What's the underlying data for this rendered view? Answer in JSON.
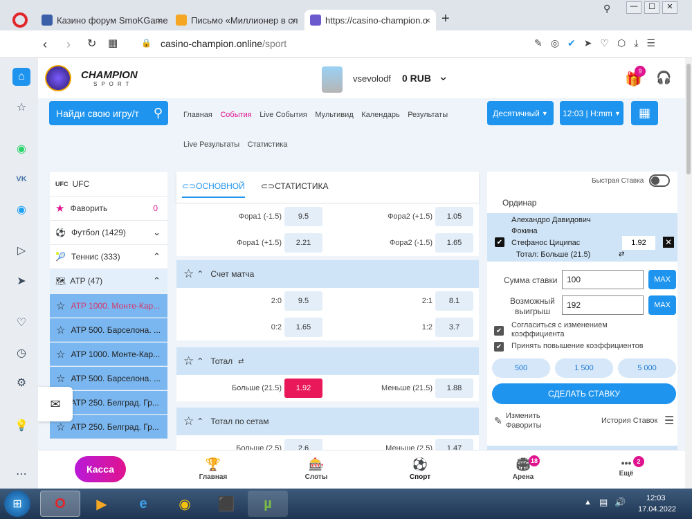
{
  "browser": {
    "tabs": [
      {
        "title": "Казино форум SmoKGame",
        "close": "×"
      },
      {
        "title": "Письмо «Миллионер в сл",
        "close": "×"
      },
      {
        "title": "https://casino-champion.o",
        "close": "×"
      }
    ],
    "new_tab": "+",
    "url_host": "casino-champion.online",
    "url_path": "/sport",
    "window_controls": [
      "—",
      "☐",
      "✕"
    ],
    "icons": [
      "search-icon",
      "menu-icon",
      "minimize-icon",
      "maximize-icon",
      "close-icon"
    ]
  },
  "site": {
    "logo_title": "CHAMPION",
    "logo_sub": "SPORT",
    "username": "vsevolodf",
    "balance": "0 RUB",
    "gift_badge": "9",
    "search_label": "Найди свою игру/т",
    "nav": [
      "Главная",
      "События",
      "Live События",
      "Мультивид",
      "Календарь",
      "Результаты",
      "Live Результаты",
      "Статистика"
    ],
    "nav_active": "События",
    "odds_format": "Десятичный",
    "time_format": "12:03 | H:mm",
    "accent": "#1e94ee"
  },
  "left_menu": {
    "items": [
      {
        "icon": "UFC",
        "label": "UFC"
      },
      {
        "icon": "★",
        "label": "Фаворить",
        "count": "0"
      },
      {
        "icon": "⚽",
        "label": "Футбол (1429)"
      },
      {
        "icon": "🎾",
        "label": "Теннис (333)"
      },
      {
        "icon": "🗺",
        "label": "ATP (47)"
      }
    ],
    "subitems": [
      "ATP 1000. Монте-Кар...",
      "ATP 500. Барселона. ...",
      "ATP 1000. Монте-Кар...",
      "ATP 500. Барселона. ...",
      "ATP 250. Белград. Гр...",
      "ATP 250. Белград. Гр..."
    ]
  },
  "main": {
    "tabs": [
      "ОСНОВНОЙ",
      "СТАТИСТИКА"
    ],
    "rows": [
      {
        "l_label": "Фора1 (-1.5)",
        "l_odd": "9.5",
        "r_label": "Фора2 (+1.5)",
        "r_odd": "1.05"
      },
      {
        "l_label": "Фора1 (+1.5)",
        "l_odd": "2.21",
        "r_label": "Фора2 (-1.5)",
        "r_odd": "1.65"
      }
    ],
    "section_score": "Счет матча",
    "score_rows": [
      {
        "l_label": "2:0",
        "l_odd": "9.5",
        "r_label": "2:1",
        "r_odd": "8.1"
      },
      {
        "l_label": "0:2",
        "l_odd": "1.65",
        "r_label": "1:2",
        "r_odd": "3.7"
      }
    ],
    "section_total": "Тотал",
    "total_row": {
      "l_label": "Больше (21.5)",
      "l_odd": "1.92",
      "r_label": "Меньше (21.5)",
      "r_odd": "1.88"
    },
    "section_sets": "Тотал по сетам",
    "sets_row": {
      "l_label": "Больше (2.5)",
      "l_odd": "2.6",
      "r_label": "Меньше (2.5)",
      "r_odd": "1.47"
    }
  },
  "betslip": {
    "quick_bet": "Быстрая Ставка",
    "tab": "Ординар",
    "match": "Алехандро Давидович Фокина Стефанос Циципас",
    "match_line1": "Алехандро Давидович",
    "match_line2": "Фокина",
    "match_line3": "Стефанос Циципас",
    "odd": "1.92",
    "market": "Тотал: Больше (21.5)",
    "stake_label": "Сумма ставки",
    "stake_value": "100",
    "win_label1": "Возможный",
    "win_label2": "выигрыш",
    "win_value": "192",
    "max": "MAX",
    "agree1": "Согласиться с изменением коэффициента",
    "agree2": "Принять повышение коэффициентов",
    "quick_amounts": [
      "500",
      "1 500",
      "5 000"
    ],
    "place_bet": "СДЕЛАТЬ СТАВКУ",
    "edit_favs1": "Изменить",
    "edit_favs2": "Фавориты",
    "history": "История Ставок"
  },
  "bottom_nav": {
    "kassa": "Касса",
    "items": [
      {
        "label": "Главная",
        "icon": "🏆"
      },
      {
        "label": "Слоты",
        "icon": "🎰"
      },
      {
        "label": "Спорт",
        "icon": "⚽"
      },
      {
        "label": "Арена",
        "icon": "🏟",
        "badge": "18"
      },
      {
        "label": "Ещё",
        "icon": "•••",
        "badge": "2"
      }
    ]
  },
  "taskbar": {
    "time": "12:03",
    "date": "17.04.2022"
  }
}
